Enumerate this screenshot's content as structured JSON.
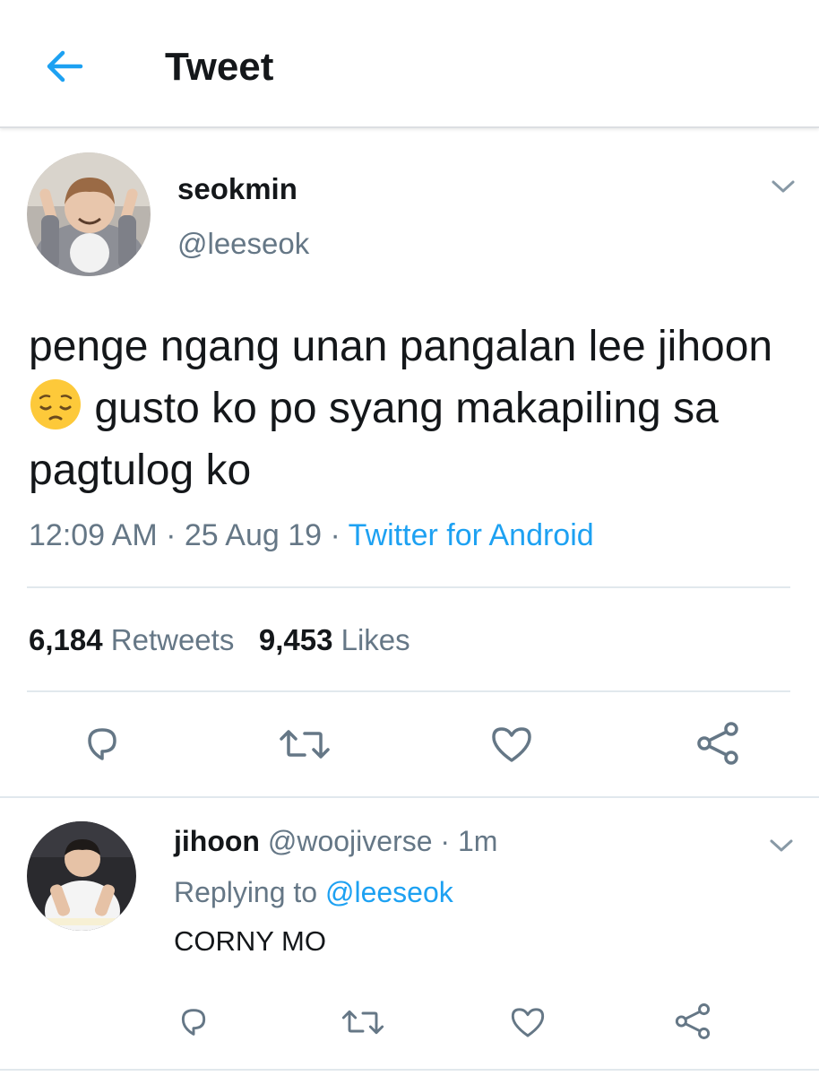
{
  "header": {
    "title": "Tweet",
    "back_icon": "arrow-left-icon"
  },
  "colors": {
    "accent": "#1da1f2",
    "text": "#14171a",
    "secondary": "#657786",
    "divider": "#e1e8ed"
  },
  "tweet": {
    "display_name": "seokmin",
    "handle": "@leeseok",
    "text_before_emoji": "penge ngang unan pangalan lee jihoon ",
    "emoji": "pensive-face-emoji",
    "text_after_emoji": " gusto ko po syang makapiling sa pagtulog ko",
    "time": "12:09 AM",
    "date": "25 Aug 19",
    "separator": "·",
    "source": "Twitter for Android",
    "retweets_count": "6,184",
    "retweets_label": "Retweets",
    "likes_count": "9,453",
    "likes_label": "Likes",
    "actions": [
      "reply-icon",
      "retweet-icon",
      "like-icon",
      "share-icon"
    ]
  },
  "reply": {
    "display_name": "jihoon",
    "handle": "@woojiverse",
    "separator": "·",
    "time": "1m",
    "replying_prefix": "Replying to",
    "replying_to": "@leeseok",
    "text": "CORNY MO",
    "actions": [
      "reply-icon",
      "retweet-icon",
      "like-icon",
      "share-icon"
    ]
  }
}
